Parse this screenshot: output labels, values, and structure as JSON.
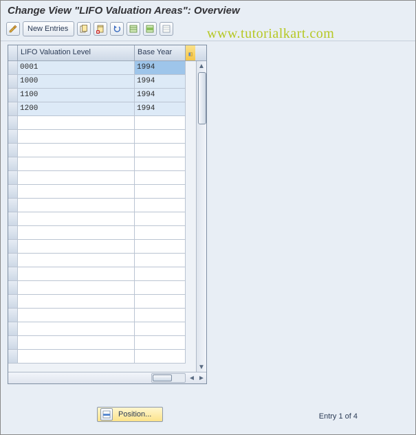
{
  "title": "Change View \"LIFO Valuation Areas\": Overview",
  "watermark": "www.tutorialkart.com",
  "toolbar": {
    "new_entries": "New Entries"
  },
  "columns": {
    "level": "LIFO Valuation Level",
    "base_year": "Base Year"
  },
  "rows": [
    {
      "level": "0001",
      "base_year": "1994",
      "selected": true
    },
    {
      "level": "1000",
      "base_year": "1994",
      "selected": false
    },
    {
      "level": "1100",
      "base_year": "1994",
      "selected": false
    },
    {
      "level": "1200",
      "base_year": "1994",
      "selected": false
    }
  ],
  "visible_row_count": 22,
  "footer": {
    "position_btn": "Position...",
    "entry_status": "Entry 1 of 4"
  }
}
